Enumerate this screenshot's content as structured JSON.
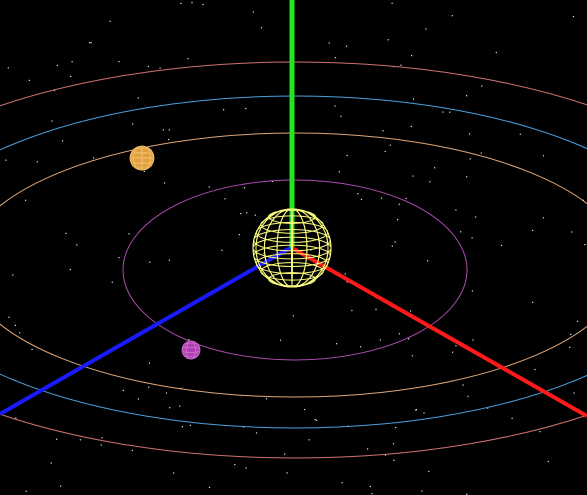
{
  "scene": {
    "background": "#000000",
    "star_color": "#e6e6e6",
    "axes": {
      "x": {
        "color": "#ff1a1a"
      },
      "y": {
        "color": "#22e622"
      },
      "z": {
        "color": "#1a1aff"
      }
    },
    "sun": {
      "color": "#ffff80",
      "style": "wireframe"
    },
    "orbits": [
      {
        "name": "inner-orbit",
        "color": "#b04cb0"
      },
      {
        "name": "third-orbit",
        "color": "#e0a878"
      },
      {
        "name": "fourth-orbit",
        "color": "#4aa0e0"
      },
      {
        "name": "outer-orbit",
        "color": "#d07070"
      }
    ],
    "planets": [
      {
        "name": "purple-planet",
        "color": "#b040b0"
      },
      {
        "name": "orange-planet",
        "color": "#e0a040"
      }
    ]
  }
}
